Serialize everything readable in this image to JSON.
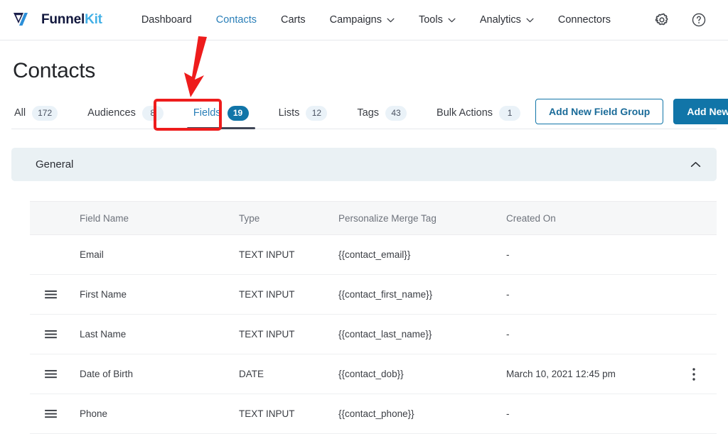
{
  "brand": {
    "name_1": "Funnel",
    "name_2": "Kit",
    "mark": "funnelkit-logo-icon"
  },
  "topnav": {
    "items": [
      {
        "label": "Dashboard",
        "has_caret": false,
        "active": false
      },
      {
        "label": "Contacts",
        "has_caret": false,
        "active": true
      },
      {
        "label": "Carts",
        "has_caret": false,
        "active": false
      },
      {
        "label": "Campaigns",
        "has_caret": true,
        "active": false
      },
      {
        "label": "Tools",
        "has_caret": true,
        "active": false
      },
      {
        "label": "Analytics",
        "has_caret": true,
        "active": false
      },
      {
        "label": "Connectors",
        "has_caret": false,
        "active": false
      }
    ],
    "settings_icon": "gear-icon",
    "help_icon": "question-circle-icon"
  },
  "page": {
    "title": "Contacts"
  },
  "tabs": [
    {
      "label": "All",
      "count": "172",
      "active": false
    },
    {
      "label": "Audiences",
      "count": "8",
      "active": false
    },
    {
      "label": "Fields",
      "count": "19",
      "active": true
    },
    {
      "label": "Lists",
      "count": "12",
      "active": false
    },
    {
      "label": "Tags",
      "count": "43",
      "active": false
    },
    {
      "label": "Bulk Actions",
      "count": "1",
      "active": false
    }
  ],
  "actions": {
    "add_group_label": "Add New Field Group",
    "add_field_label": "Add New Field"
  },
  "group": {
    "title": "General",
    "collapse_icon": "chevron-up-icon",
    "expanded": true
  },
  "table": {
    "columns": [
      "Field Name",
      "Type",
      "Personalize Merge Tag",
      "Created On"
    ],
    "rows": [
      {
        "handle": false,
        "name": "Email",
        "type": "TEXT INPUT",
        "tag": "{{contact_email}}",
        "created": "-",
        "menu": false
      },
      {
        "handle": true,
        "name": "First Name",
        "type": "TEXT INPUT",
        "tag": "{{contact_first_name}}",
        "created": "-",
        "menu": false
      },
      {
        "handle": true,
        "name": "Last Name",
        "type": "TEXT INPUT",
        "tag": "{{contact_last_name}}",
        "created": "-",
        "menu": false
      },
      {
        "handle": true,
        "name": "Date of Birth",
        "type": "DATE",
        "tag": "{{contact_dob}}",
        "created": "March 10, 2021 12:45 pm",
        "menu": true
      },
      {
        "handle": true,
        "name": "Phone",
        "type": "TEXT INPUT",
        "tag": "{{contact_phone}}",
        "created": "-",
        "menu": false
      }
    ]
  },
  "annotation": {
    "arrow_color": "#ee1c1c",
    "highlight_color": "#ee1c1c",
    "arrow_name": "red-arrow-pointing-to-fields-tab",
    "highlight_name": "red-highlight-box-around-fields-tab"
  },
  "colors": {
    "accent": "#1175a8",
    "link": "#2a7fb8",
    "badge_bg": "#eaf2f8",
    "group_bg": "#eaf1f4",
    "annotation": "#ee1c1c"
  }
}
